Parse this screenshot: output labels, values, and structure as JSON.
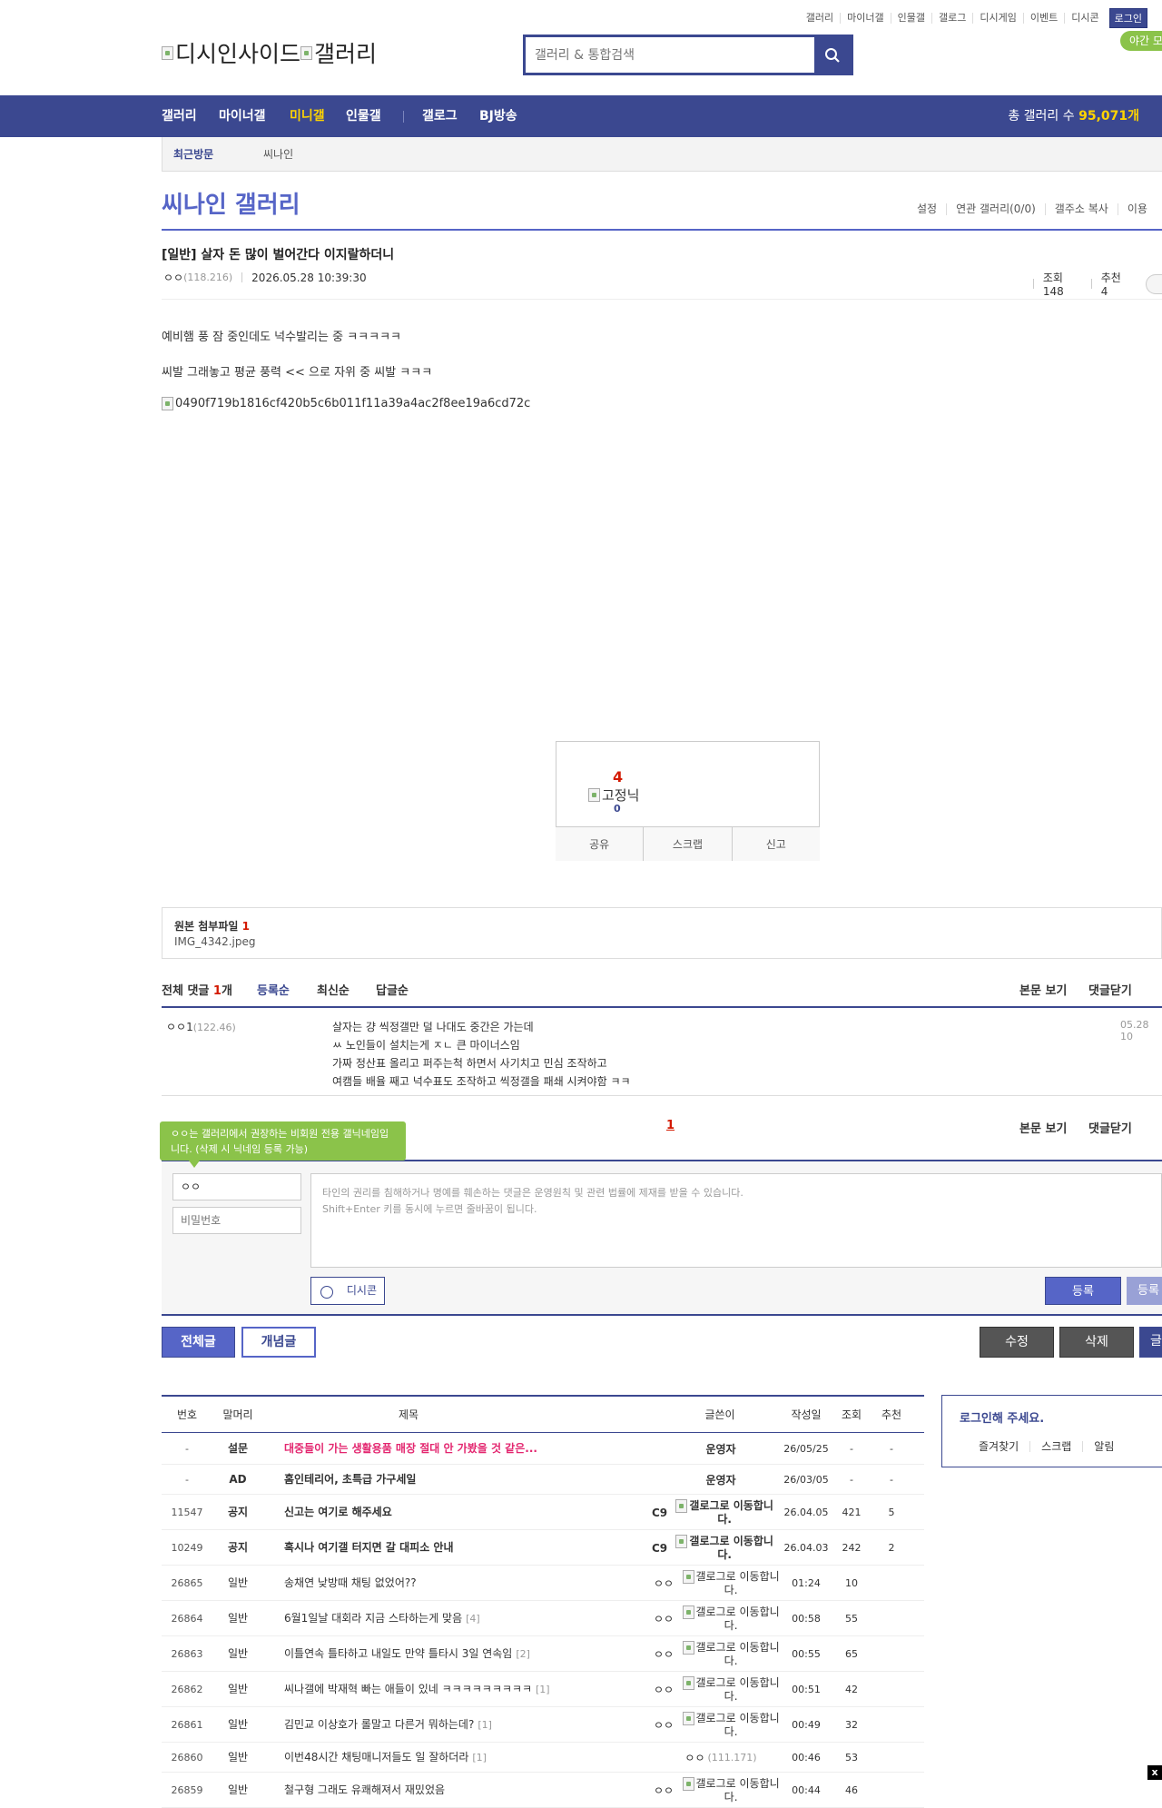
{
  "top_links": [
    "갤러리",
    "마이너갤",
    "인물갤",
    "갤로그",
    "디시게임",
    "이벤트",
    "디시콘"
  ],
  "login_label": "로그인",
  "night_mode_label": "야간 모",
  "logo": {
    "site_alt": "디시인사이드",
    "gallery_alt": "갤러리"
  },
  "search": {
    "placeholder": "갤러리 & 통합검색"
  },
  "nav": {
    "items": [
      "갤러리",
      "마이너갤",
      "미니갤",
      "인물갤",
      "갤로그",
      "BJ방송"
    ],
    "active": "미니갤",
    "total_prefix": "총 갤러리 수",
    "total_count": "95,071개"
  },
  "recent": {
    "label": "최근방문",
    "item": "씨나인"
  },
  "gallery": {
    "title": "씨나인 갤러리",
    "tools": [
      "설정",
      "연관 갤러리(0/0)",
      "갤주소 복사",
      "이용"
    ]
  },
  "post": {
    "title": "[일반] 살자 돈 많이 벌어간다 이지랄하더니",
    "author": "ㅇㅇ",
    "author_ip": "(118.216)",
    "datetime": "2026.05.28 10:39:30",
    "views_label": "조회 148",
    "recommend_label": "추천 4",
    "body_lines": [
      "예비햄 풍 잠 중인데도 넉수발리는 중 ㅋㅋㅋㅋㅋ",
      "씨발 그래놓고 평균 풍력 << 으로 자위 중 씨발 ㅋㅋㅋ"
    ],
    "image_alt": "0490f719b1816cf420b5c6b011f11a39a4ac2f8ee19a6cd72c"
  },
  "recommend_box": {
    "count": "4",
    "fixed_nick_alt": "고정닉",
    "fixed_nick_count": "0",
    "buttons": [
      "공유",
      "스크랩",
      "신고"
    ]
  },
  "attachments": {
    "label": "원본 첨부파일",
    "count": "1",
    "file": "IMG_4342.jpeg"
  },
  "comments": {
    "total_label": "전체 댓글",
    "total_count": "1",
    "total_unit": "개",
    "sorts": [
      "등록순",
      "최신순",
      "답글순"
    ],
    "right_links": [
      "본문 보기",
      "댓글닫기"
    ],
    "items": [
      {
        "nick": "ㅇㅇ1",
        "ip": "(122.46)",
        "lines": [
          "살자는 걍 씩정갤만 덜 나대도 중간은 가는데",
          "ㅆ 노인들이 설치는게 ㅈㄴ 큰 마이너스임",
          "가짜 정산표 올리고 퍼주는척 하면서 사기치고 민심 조작하고",
          "여캠들 배율 째고 넉수표도 조작하고 씩정갤을 패쇄 시켜야함 ㅋㅋ"
        ],
        "date": "05.28 10"
      }
    ],
    "page": "1"
  },
  "comment_form": {
    "tooltip": "ㅇㅇ는 갤러리에서 권장하는 비회원 전용 갤닉네임입니다. (삭제 시 닉네임 등록 가능)",
    "nick_value": "ㅇㅇ",
    "password_placeholder": "비밀번호",
    "textarea_placeholder_line1": "타인의 권리를 침해하거나 명예를 훼손하는 댓글은 운영원칙 및 관련 법률에 제재를 받을 수 있습니다.",
    "textarea_placeholder_line2": "Shift+Enter 키를 동시에 누르면 줄바꿈이 됩니다.",
    "dccon_label": "디시콘",
    "submit_label": "등록",
    "submit2_label": "등록"
  },
  "list_buttons": {
    "all": "전체글",
    "concept": "개념글",
    "edit": "수정",
    "delete": "삭제",
    "write": "글"
  },
  "list": {
    "headers": [
      "번호",
      "말머리",
      "제목",
      "글쓴이",
      "작성일",
      "조회",
      "추천"
    ],
    "rows": [
      {
        "num": "-",
        "head": "설문",
        "subject": "대중들이 가는 생활용품 매장 절대 안 가봤을 것 같은...",
        "style": "pink",
        "writer": "운영자",
        "writer_type": "bold",
        "date": "26/05/25",
        "views": "-",
        "rec": "-"
      },
      {
        "num": "-",
        "head": "AD",
        "subject": "홈인테리어, 초특급 가구세일",
        "style": "bold",
        "writer": "운영자",
        "writer_type": "bold",
        "date": "26/03/05",
        "views": "-",
        "rec": "-"
      },
      {
        "num": "11547",
        "head": "공지",
        "subject": "신고는 여기로 해주세요",
        "style": "bold",
        "writer": "C9",
        "writer_type": "gallog",
        "date": "26.04.05",
        "views": "421",
        "rec": "5"
      },
      {
        "num": "10249",
        "head": "공지",
        "subject": "혹시나 여기갤 터지면 갈 대피소 안내",
        "style": "bold",
        "writer": "C9",
        "writer_type": "gallog",
        "date": "26.04.03",
        "views": "242",
        "rec": "2"
      },
      {
        "num": "26865",
        "head": "일반",
        "subject": "송채연 낮방때 채팅 없었어??",
        "style": "normal",
        "writer": "ㅇㅇ",
        "writer_type": "gallog",
        "date": "01:24",
        "views": "10",
        "rec": ""
      },
      {
        "num": "26864",
        "head": "일반",
        "subject": "6월1일날 대회라 지금 스타하는게 맞음",
        "cmt": "[4]",
        "style": "normal",
        "writer": "ㅇㅇ",
        "writer_type": "gallog",
        "date": "00:58",
        "views": "55",
        "rec": ""
      },
      {
        "num": "26863",
        "head": "일반",
        "subject": "이틀연속 틀타하고 내일도 만약 틀타시 3일 연속임",
        "cmt": "[2]",
        "style": "normal",
        "writer": "ㅇㅇ",
        "writer_type": "gallog",
        "date": "00:55",
        "views": "65",
        "rec": ""
      },
      {
        "num": "26862",
        "head": "일반",
        "subject": "씨나갤에 박재혁 빠는 애들이 있네 ㅋㅋㅋㅋㅋㅋㅋㅋㅋ",
        "cmt": "[1]",
        "style": "normal",
        "writer": "ㅇㅇ",
        "writer_type": "gallog",
        "date": "00:51",
        "views": "42",
        "rec": ""
      },
      {
        "num": "26861",
        "head": "일반",
        "subject": "김민교 이상호가 롤말고 다른거 뭐하는데?",
        "cmt": "[1]",
        "style": "normal",
        "writer": "ㅇㅇ",
        "writer_type": "gallog",
        "date": "00:49",
        "views": "32",
        "rec": ""
      },
      {
        "num": "26860",
        "head": "일반",
        "subject": "이번48시간 채팅매니저들도 일 잘하더라",
        "cmt": "[1]",
        "style": "normal",
        "writer": "ㅇㅇ",
        "writer_type": "ip",
        "writer_ip": "(111.171)",
        "date": "00:46",
        "views": "53",
        "rec": ""
      },
      {
        "num": "26859",
        "head": "일반",
        "subject": "철구형 그래도 유쾌해져서 재밌었음",
        "style": "normal",
        "writer": "ㅇㅇ",
        "writer_type": "gallog",
        "date": "00:44",
        "views": "46",
        "rec": ""
      }
    ],
    "gallog_alt": "갤로그로 이동합니다."
  },
  "login_box": {
    "message": "로그인해 주세요.",
    "tools": [
      "즐겨찾기",
      "스크랩",
      "알림"
    ]
  },
  "colors": {
    "brand": "#3b4890",
    "accent": "#5665c7",
    "highlight": "#ffd400",
    "red": "#d31900",
    "green": "#8bc34a"
  }
}
